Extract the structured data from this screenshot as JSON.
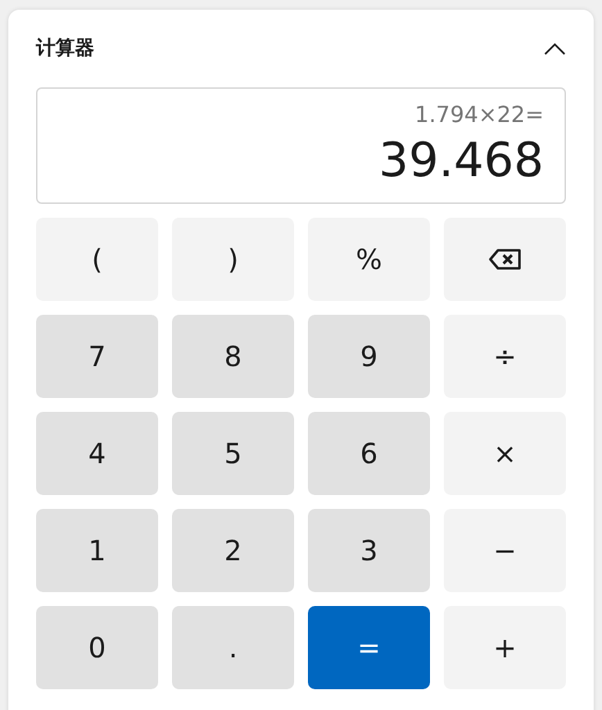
{
  "title": "计算器",
  "collapse": {
    "expanded": true
  },
  "display": {
    "expression": "1.794×22=",
    "result": "39.468"
  },
  "keys": [
    {
      "kind": "function",
      "label": "("
    },
    {
      "kind": "function",
      "label": ")"
    },
    {
      "kind": "function",
      "label": "%"
    },
    {
      "kind": "backspace"
    },
    {
      "kind": "digit",
      "label": "7"
    },
    {
      "kind": "digit",
      "label": "8"
    },
    {
      "kind": "digit",
      "label": "9"
    },
    {
      "kind": "function",
      "label": "÷"
    },
    {
      "kind": "digit",
      "label": "4"
    },
    {
      "kind": "digit",
      "label": "5"
    },
    {
      "kind": "digit",
      "label": "6"
    },
    {
      "kind": "function",
      "label": "×"
    },
    {
      "kind": "digit",
      "label": "1"
    },
    {
      "kind": "digit",
      "label": "2"
    },
    {
      "kind": "digit",
      "label": "3"
    },
    {
      "kind": "function",
      "label": "−"
    },
    {
      "kind": "digit",
      "label": "0"
    },
    {
      "kind": "digit",
      "label": "."
    },
    {
      "kind": "equals",
      "label": "="
    },
    {
      "kind": "function",
      "label": "+"
    }
  ]
}
